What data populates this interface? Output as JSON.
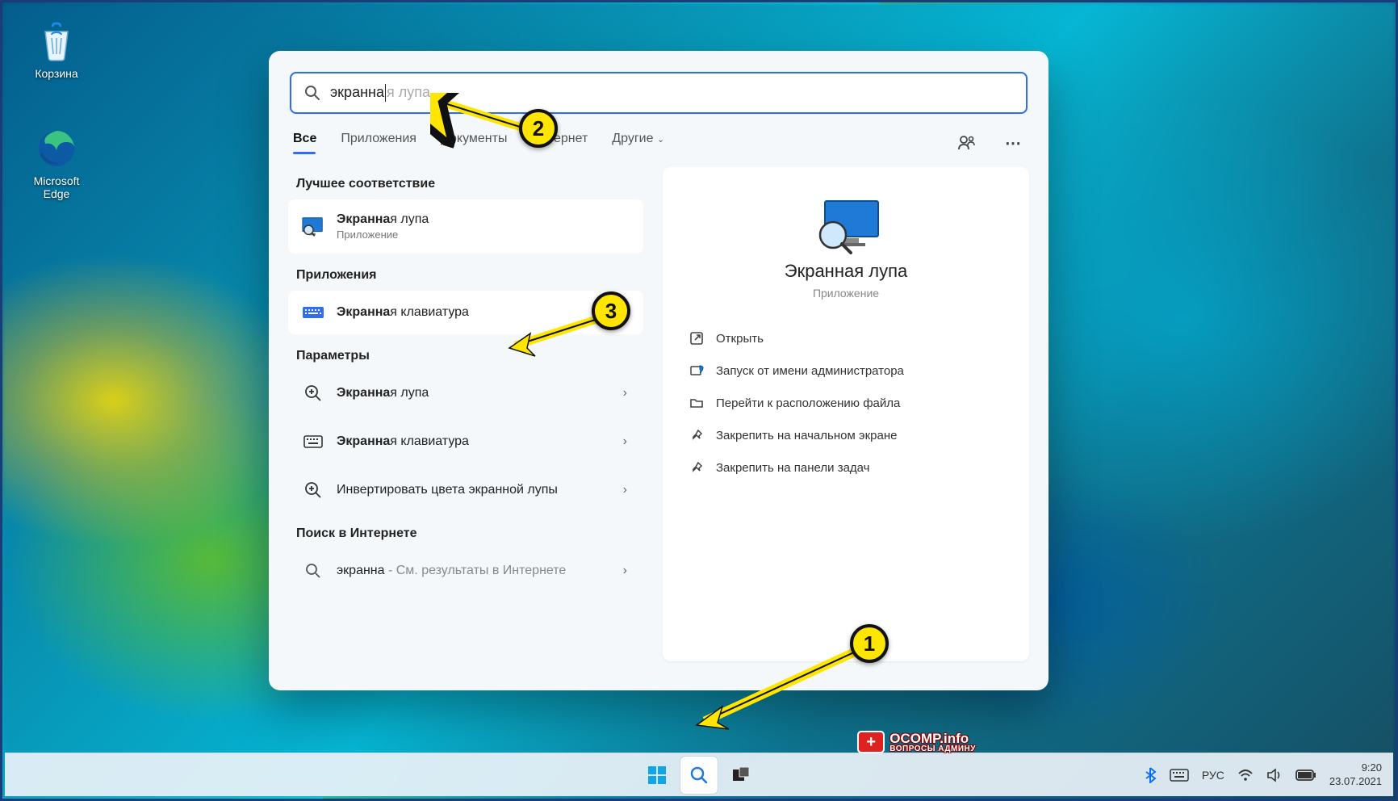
{
  "desktop": {
    "recycle_label": "Корзина",
    "edge_label": "Microsoft Edge"
  },
  "search": {
    "query_typed": "экранна",
    "query_hint": "я лупа",
    "tabs": {
      "all": "Все",
      "apps": "Приложения",
      "docs": "Документы",
      "web": "Интернет",
      "more": "Другие"
    },
    "sections": {
      "best": "Лучшее соответствие",
      "apps": "Приложения",
      "params": "Параметры",
      "web": "Поиск в Интернете"
    },
    "best_match": {
      "title_bold": "Экранна",
      "title_rest": "я лупа",
      "subtitle": "Приложение"
    },
    "app_result": {
      "title_bold": "Экранна",
      "title_rest": "я клавиатура"
    },
    "params": [
      {
        "title_bold": "Экранна",
        "title_rest": "я лупа",
        "icon": "zoom"
      },
      {
        "title_bold": "Экранна",
        "title_rest": "я клавиатура",
        "icon": "keyboard"
      },
      {
        "title_bold": "",
        "title_rest": "Инвертировать цвета экранной лупы",
        "icon": "zoom"
      }
    ],
    "web_result": {
      "query": "экранна",
      "suffix": " - См. результаты в Интернете"
    },
    "preview": {
      "title": "Экранная лупа",
      "subtitle": "Приложение",
      "actions": {
        "open": "Открыть",
        "admin": "Запуск от имени администратора",
        "location": "Перейти к расположению файла",
        "pin_start": "Закрепить на начальном экране",
        "pin_taskbar": "Закрепить на панели задач"
      }
    }
  },
  "taskbar": {
    "lang": "РУС",
    "time": "9:20",
    "date": "23.07.2021"
  },
  "watermark": {
    "site": "OCOMP.info",
    "tagline": "ВОПРОСЫ АДМИНУ"
  },
  "annotations": {
    "n1": "1",
    "n2": "2",
    "n3": "3"
  }
}
